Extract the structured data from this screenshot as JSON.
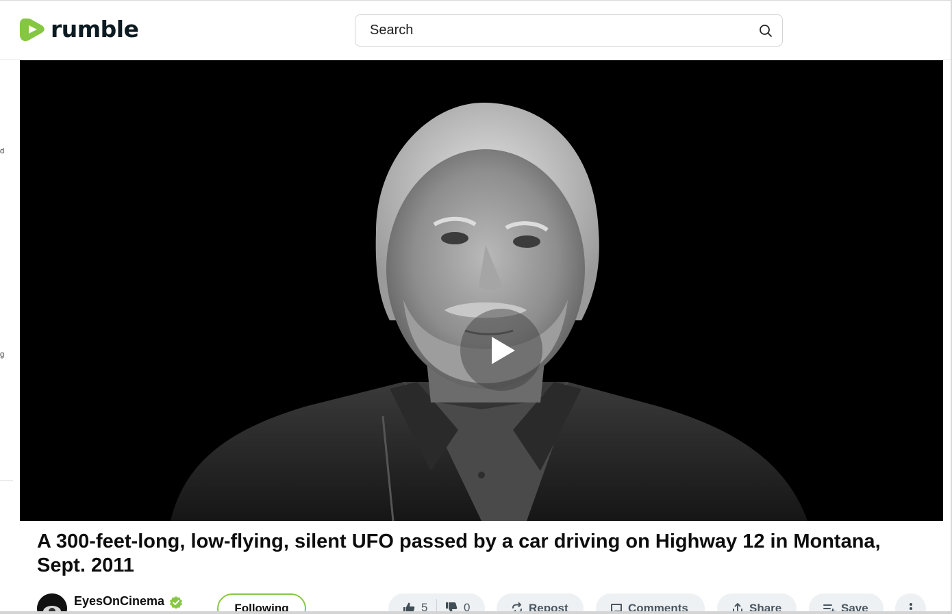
{
  "brand": {
    "name": "rumble",
    "accent": "#85c742"
  },
  "search": {
    "placeholder": "Search",
    "icon": "search-icon"
  },
  "sidebar_sliver": [
    "d",
    "g"
  ],
  "player": {
    "state": "paused",
    "play_icon": "play-icon"
  },
  "video": {
    "title": "A 300-feet-long, low-flying, silent UFO passed by a car driving on Highway 12 in Montana, Sept. 2011"
  },
  "channel": {
    "name": "EyesOnCinema",
    "verified": true,
    "follow_label": "Following"
  },
  "actions": {
    "likes": "5",
    "dislikes": "0",
    "repost_label": "Repost",
    "comments_label": "Comments",
    "share_label": "Share",
    "save_label": "Save"
  }
}
